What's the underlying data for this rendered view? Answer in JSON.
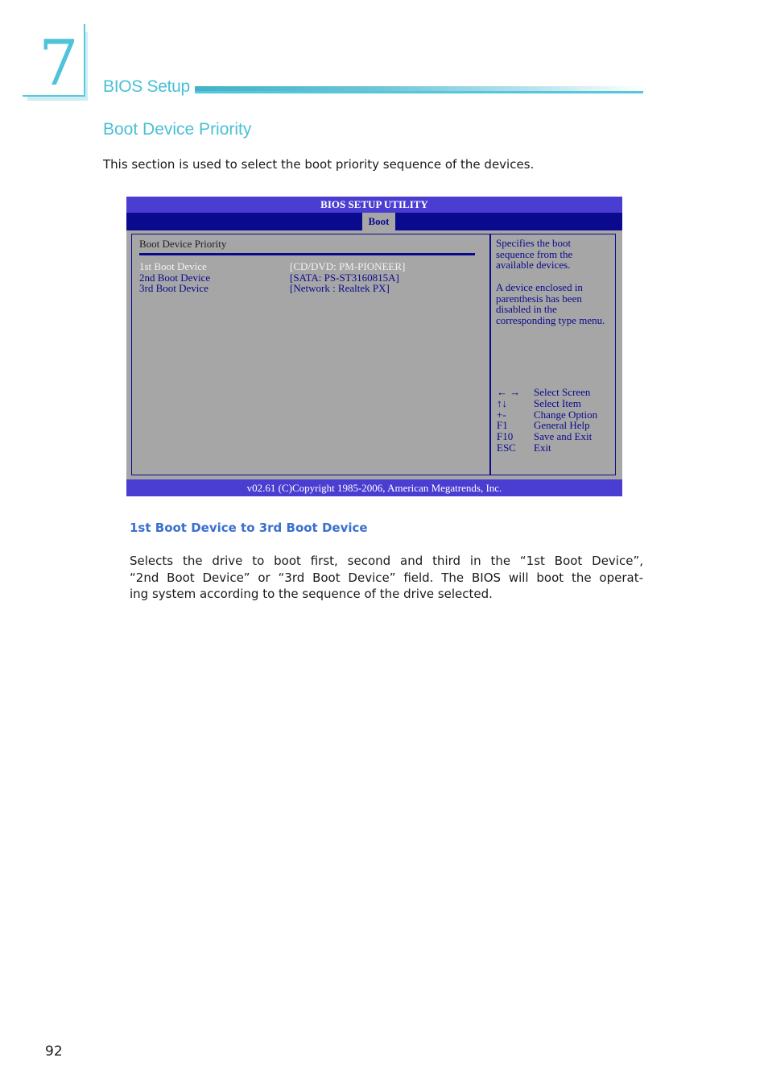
{
  "chapter": {
    "number": "7",
    "title": "BIOS Setup"
  },
  "section": {
    "title": "Boot Device Priority",
    "intro": "This section is used to select the boot priority sequence of the devices."
  },
  "bios": {
    "title": "BIOS SETUP UTILITY",
    "active_tab": "Boot",
    "panel_heading": "Boot Device Priority",
    "items": [
      {
        "label": "1st Boot Device",
        "value": "[CD/DVD: PM-PIONEER]",
        "selected": true
      },
      {
        "label": "2nd Boot Device",
        "value": "[SATA: PS-ST3160815A]",
        "selected": false
      },
      {
        "label": "3rd Boot Device",
        "value": "[Network : Realtek PX]",
        "selected": false
      }
    ],
    "help": [
      "Specifies the boot sequence from the available devices.",
      "A device enclosed in parenthesis has been disabled in the corresponding type menu."
    ],
    "keys": [
      {
        "key": "← →",
        "desc": "Select Screen"
      },
      {
        "key": "↑↓",
        "desc": "Select Item"
      },
      {
        "key": "+-",
        "desc": "Change Option"
      },
      {
        "key": "F1",
        "desc": "General Help"
      },
      {
        "key": "F10",
        "desc": "Save and Exit"
      },
      {
        "key": "ESC",
        "desc": "Exit"
      }
    ],
    "footer": "v02.61 (C)Copyright 1985-2006, American Megatrends, Inc."
  },
  "subsection": {
    "title": "1st Boot Device to 3rd Boot Device",
    "lines": [
      "Selects the drive to boot first, second and third in the “1st Boot Device”,",
      "“2nd Boot Device”  or “3rd Boot Device” field. The BIOS will boot the operat-",
      "ing system according to the sequence of the drive selected."
    ]
  },
  "page_number": "92",
  "colors": {
    "accent": "#4bbfd6",
    "bios_title_bar": "#4a3dd1",
    "bios_navy": "#0a0a8e",
    "bios_background": "#a6a6a6",
    "subheading": "#3a6fd0"
  }
}
